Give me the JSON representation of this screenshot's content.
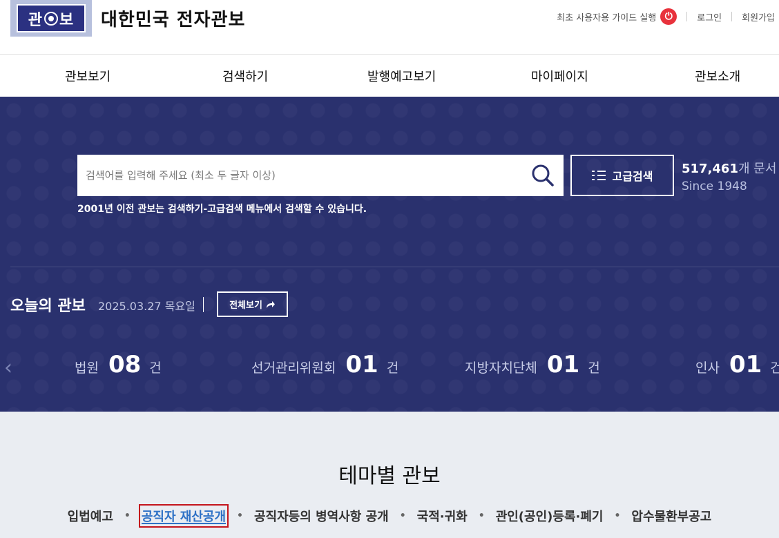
{
  "header": {
    "logo_text_left": "관",
    "logo_text_right": "보",
    "site_title": "대한민국 전자관보",
    "guide_label": "최초 사용자용 가이드 실행",
    "login_label": "로그인",
    "signup_label": "회원가입"
  },
  "nav": {
    "items": [
      {
        "label": "관보보기"
      },
      {
        "label": "검색하기"
      },
      {
        "label": "발행예고보기"
      },
      {
        "label": "마이페이지"
      },
      {
        "label": "관보소개"
      }
    ]
  },
  "search": {
    "placeholder": "검색어를 입력해 주세요 (최소 두 글자 이상)",
    "value": "",
    "advanced_label": "고급검색",
    "note": "2001년 이전 관보는 검색하기-고급검색 메뉴에서 검색할 수 있습니다."
  },
  "stats": {
    "doc_count": "517,461",
    "doc_unit": "개 문서",
    "since": "Since 1948"
  },
  "today": {
    "title": "오늘의 관보",
    "date": "2025.03.27 목요일",
    "view_all_label": "전체보기",
    "categories": [
      {
        "name": "법원",
        "count": "08",
        "unit": "건"
      },
      {
        "name": "선거관리위원회",
        "count": "01",
        "unit": "건"
      },
      {
        "name": "지방자치단체",
        "count": "01",
        "unit": "건"
      },
      {
        "name": "인사",
        "count": "01",
        "unit": "건"
      }
    ]
  },
  "theme": {
    "title": "테마별 관보",
    "items": [
      {
        "label": "입법예고"
      },
      {
        "label": "공직자 재산공개"
      },
      {
        "label": "공직자등의 병역사항 공개"
      },
      {
        "label": "국적·귀화"
      },
      {
        "label": "관인(공인)등록·폐기"
      },
      {
        "label": "압수물환부공고"
      }
    ],
    "active_index": 1
  },
  "colors": {
    "hero_bg": "#2a316e",
    "power_red": "#e8323c",
    "active_link": "#2f72c6",
    "highlight_border": "#c4141c"
  }
}
